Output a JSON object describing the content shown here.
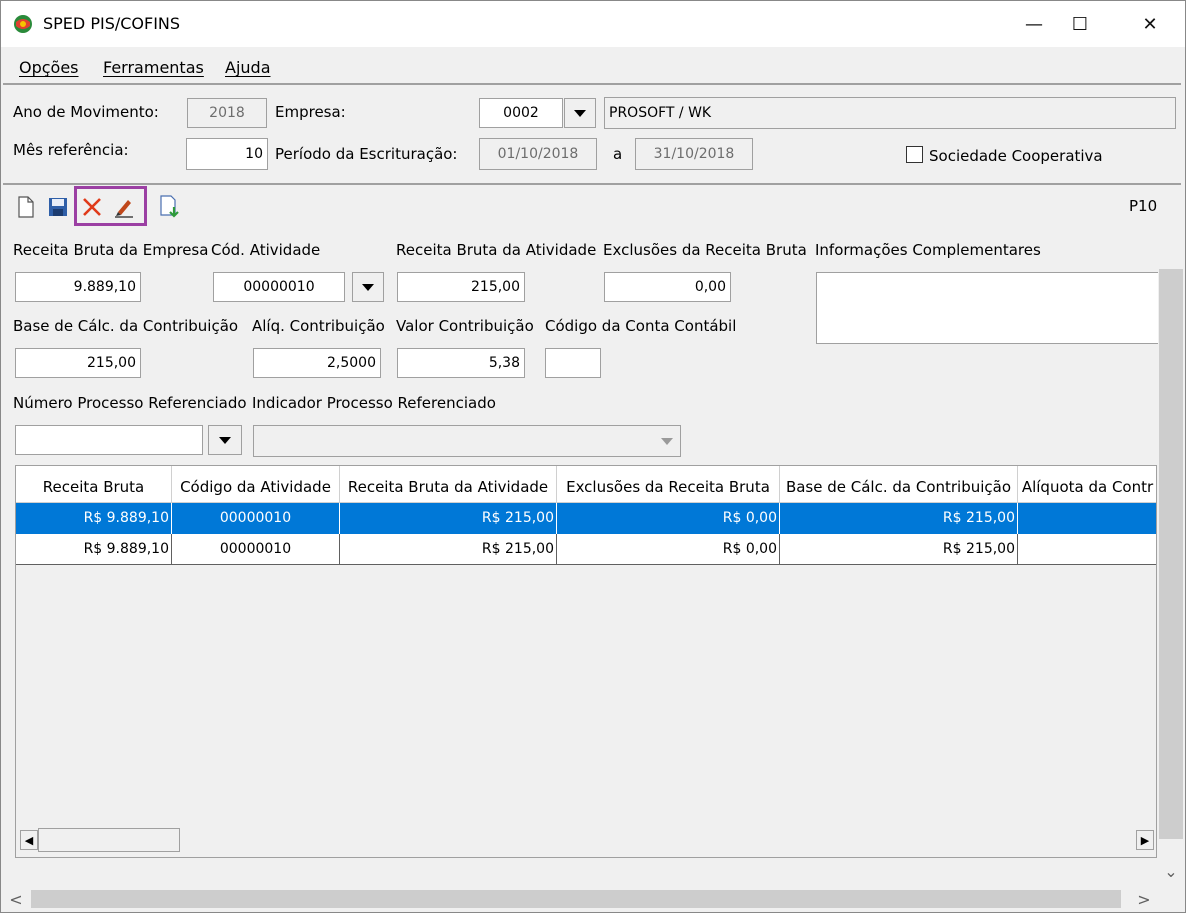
{
  "window": {
    "title": "SPED PIS/COFINS",
    "minimize": "—",
    "maximize": "☐",
    "close": "✕"
  },
  "menu": [
    "Opções",
    "Ferramentas",
    "Ajuda"
  ],
  "top": {
    "ano_label": "Ano de Movimento:",
    "ano_value": "2018",
    "empresa_label": "Empresa:",
    "empresa_code": "0002",
    "empresa_name": "PROSOFT / WK",
    "mes_label": "Mês referência:",
    "mes_value": "10",
    "periodo_label": "Período da Escrituração:",
    "periodo_inicio": "01/10/2018",
    "periodo_sep": "a",
    "periodo_fim": "31/10/2018",
    "coop_label": "Sociedade Cooperativa"
  },
  "toolbar": {
    "right_text": "P10"
  },
  "form": {
    "receita_bruta_empresa_label": "Receita Bruta da Empresa",
    "receita_bruta_empresa": "9.889,10",
    "cod_atividade_label": "Cód. Atividade",
    "cod_atividade": "00000010",
    "receita_bruta_atividade_label": "Receita Bruta da Atividade",
    "receita_bruta_atividade": "215,00",
    "exclusoes_label": "Exclusões da Receita Bruta",
    "exclusoes": "0,00",
    "info_label": "Informações Complementares",
    "base_label": "Base de Cálc. da Contribuição",
    "base": "215,00",
    "aliq_label": "Alíq. Contribuição",
    "aliq": "2,5000",
    "valor_label": "Valor Contribuição",
    "valor": "5,38",
    "conta_label": "Código da Conta Contábil",
    "num_proc_label": "Número Processo Referenciado",
    "ind_proc_label": "Indicador Processo Referenciado"
  },
  "grid": {
    "headers": [
      "Receita Bruta",
      "Código da Atividade",
      "Receita Bruta da Atividade",
      "Exclusões da Receita Bruta",
      "Base de Cálc. da Contribuição",
      "Alíquota da Contr"
    ],
    "rows": [
      [
        "R$ 9.889,10",
        "00000010",
        "R$ 215,00",
        "R$ 0,00",
        "R$ 215,00",
        ""
      ],
      [
        "R$ 9.889,10",
        "00000010",
        "R$ 215,00",
        "R$ 0,00",
        "R$ 215,00",
        ""
      ]
    ]
  },
  "scroll": {
    "left": "◀",
    "right": "▶",
    "down": "⌄",
    "page_left": "<",
    "page_right": ">"
  }
}
